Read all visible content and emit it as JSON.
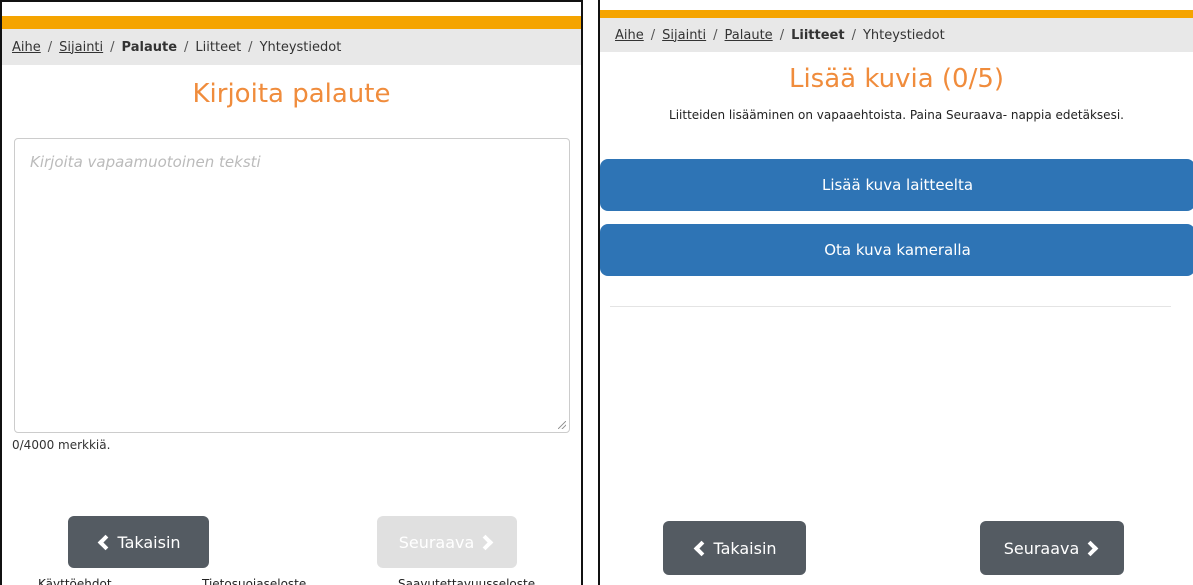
{
  "left": {
    "breadcrumbs": [
      "Aihe",
      "Sijainti",
      "Palaute",
      "Liitteet",
      "Yhteystiedot"
    ],
    "title": "Kirjoita palaute",
    "textarea_placeholder": "Kirjoita vapaamuotoinen teksti",
    "char_count": "0/4000 merkkiä.",
    "back_label": "Takaisin",
    "next_label": "Seuraava",
    "footer": [
      "Käyttöehdot",
      "Tietosuojaseloste",
      "Saavutettavuusseloste"
    ]
  },
  "right": {
    "breadcrumbs": [
      "Aihe",
      "Sijainti",
      "Palaute",
      "Liitteet",
      "Yhteystiedot"
    ],
    "title": "Lisää kuvia (0/5)",
    "info": "Liitteiden lisääminen on vapaaehtoista. Paina Seuraava- nappia edetäksesi.",
    "add_from_device": "Lisää kuva laitteelta",
    "take_photo": "Ota kuva kameralla",
    "back_label": "Takaisin",
    "next_label": "Seuraava"
  },
  "colors": {
    "accent_bar": "#f5a400",
    "title": "#f08c3c",
    "primary_button": "#2e74b5",
    "dark_button": "#545b62"
  }
}
